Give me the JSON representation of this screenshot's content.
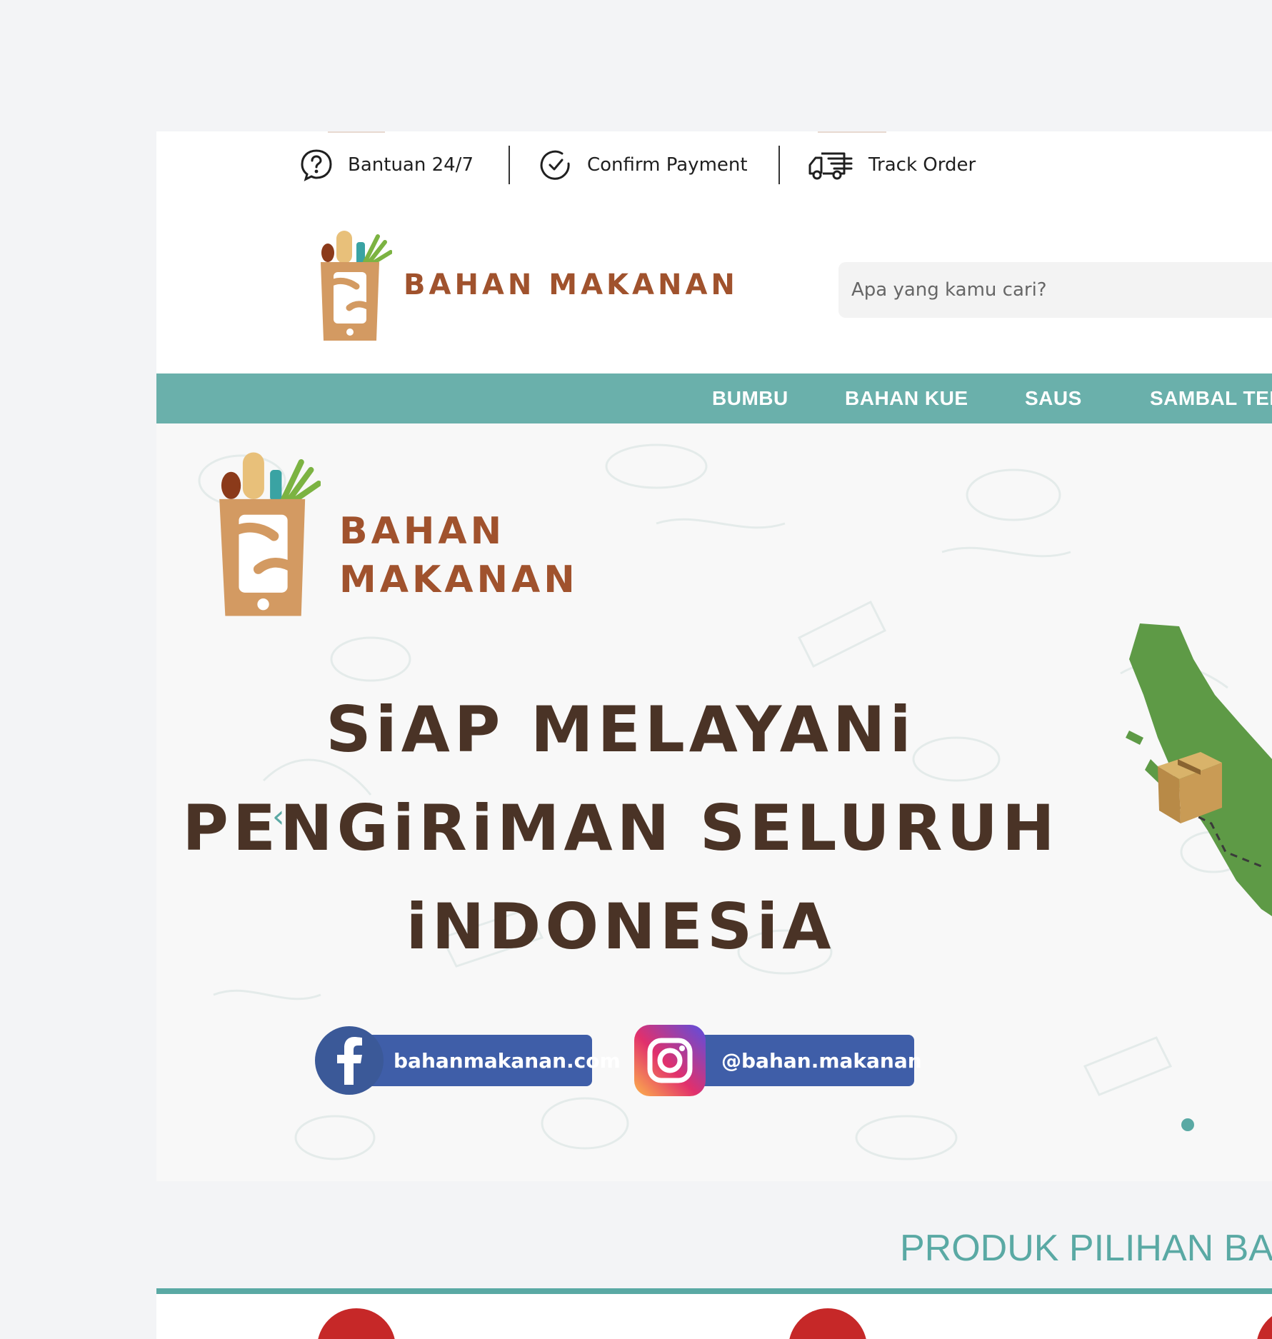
{
  "topbar": {
    "help": "Bantuan 24/7",
    "confirm": "Confirm Payment",
    "track": "Track Order"
  },
  "header": {
    "logo_text": "BAHAN MAKANAN",
    "search_placeholder": "Apa yang kamu cari?"
  },
  "nav": {
    "items": [
      "BUMBU",
      "BAHAN KUE",
      "SAUS",
      "SAMBAL TERA"
    ]
  },
  "banner": {
    "logo_line1": "BAHAN",
    "logo_line2": "MAKANAN",
    "title_line1": "SiAP MELAYANi",
    "title_line2": "PENGiRiMAN SELURUH",
    "title_line3": "iNDONESiA",
    "facebook": "bahanmakanan.com",
    "instagram": "@bahan.makanan"
  },
  "section": {
    "title": "PRODUK PILIHAN BA"
  },
  "colors": {
    "accent": "#6ab0ab",
    "brand_brown": "#a0522d",
    "map_green": "#5e9a46"
  }
}
